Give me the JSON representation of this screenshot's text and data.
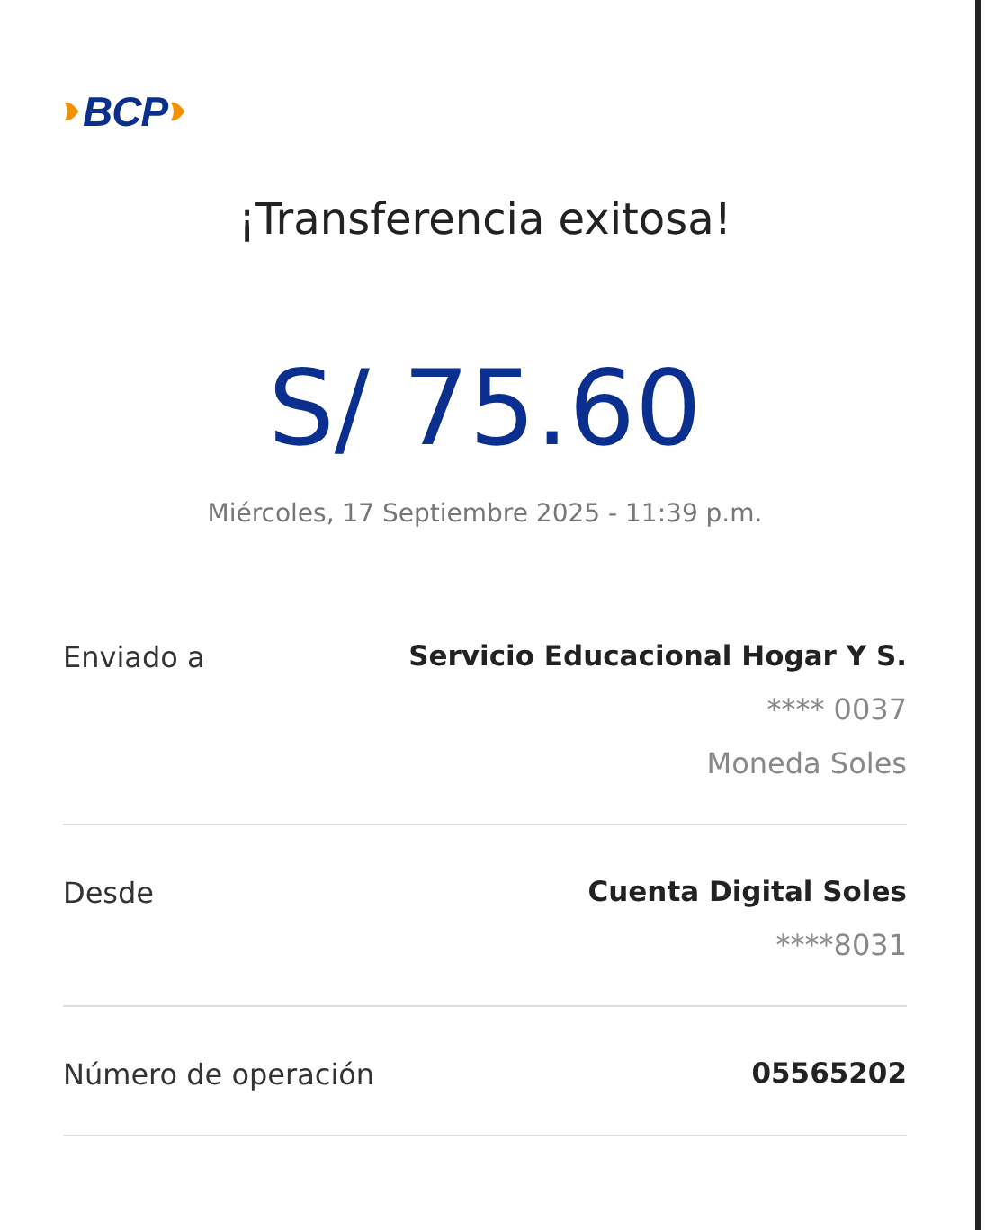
{
  "logo": {
    "text": "BCP"
  },
  "title": "¡Transferencia exitosa!",
  "amount": "S/ 75.60",
  "date": "Miércoles, 17 Septiembre 2025 - 11:39 p.m.",
  "details": [
    {
      "label": "Enviado a",
      "lines": [
        "Servicio Educacional Hogar Y S.",
        "**** 0037",
        "Moneda Soles"
      ]
    },
    {
      "label": "Desde",
      "lines": [
        "Cuenta Digital Soles",
        "****8031"
      ]
    },
    {
      "label": "Número de operación",
      "lines": [
        "05565202"
      ]
    }
  ]
}
